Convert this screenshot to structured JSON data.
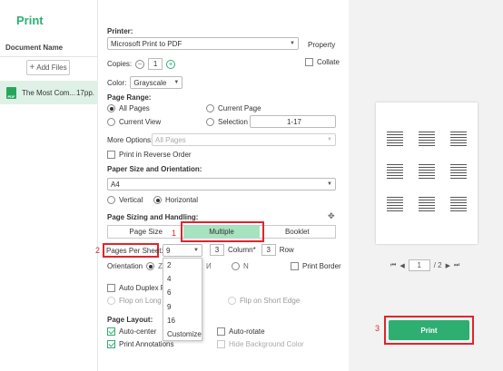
{
  "app": {
    "title": "Print"
  },
  "sidebar": {
    "heading": "Document Name",
    "add_files": "Add Files",
    "file": {
      "name": "The Most Com...",
      "pages": "17pp."
    }
  },
  "printer": {
    "label": "Printer:",
    "value": "Microsoft Print to PDF",
    "property": "Property",
    "copies_label": "Copies:",
    "copies": "1",
    "collate": "Collate",
    "color_label": "Color:",
    "color": "Grayscale"
  },
  "page_range": {
    "label": "Page Range:",
    "all_pages": "All Pages",
    "current_page": "Current Page",
    "current_view": "Current View",
    "selection": "Selection",
    "range": "1-17",
    "more_options_label": "More Options:",
    "more_options": "All Pages",
    "reverse": "Print in Reverse Order"
  },
  "paper": {
    "label": "Paper Size and Orientation:",
    "size": "A4",
    "vertical": "Vertical",
    "horizontal": "Horizontal"
  },
  "sizing": {
    "label": "Page Sizing and Handling:",
    "page_size": "Page Size",
    "multiple": "Multiple",
    "booklet": "Booklet",
    "pages_per_sheet_label": "Pages Per Sheet:",
    "pages_per_sheet": "9",
    "columns": "3",
    "column_label": "Column*",
    "rows": "3",
    "row_label": "Row",
    "orientation_label": "Orientation",
    "print_border": "Print Border",
    "auto_duplex": "Auto Duplex Pri",
    "flip_long": "Flop on Long E",
    "flip_short": "Flip on Short Edge",
    "options": [
      "2",
      "4",
      "6",
      "9",
      "16",
      "Customize"
    ]
  },
  "layout": {
    "label": "Page Layout:",
    "auto_center": "Auto-center",
    "auto_rotate": "Auto-rotate",
    "print_annotations": "Print Annotations",
    "hide_bg": "Hide Background Color"
  },
  "preview": {
    "page": "1",
    "total": "/ 2"
  },
  "print_button": "Print",
  "annotations": {
    "step1": "1",
    "step2": "2",
    "step3": "3"
  },
  "colors": {
    "accent": "#2fae72",
    "highlight": "#e0252d"
  }
}
